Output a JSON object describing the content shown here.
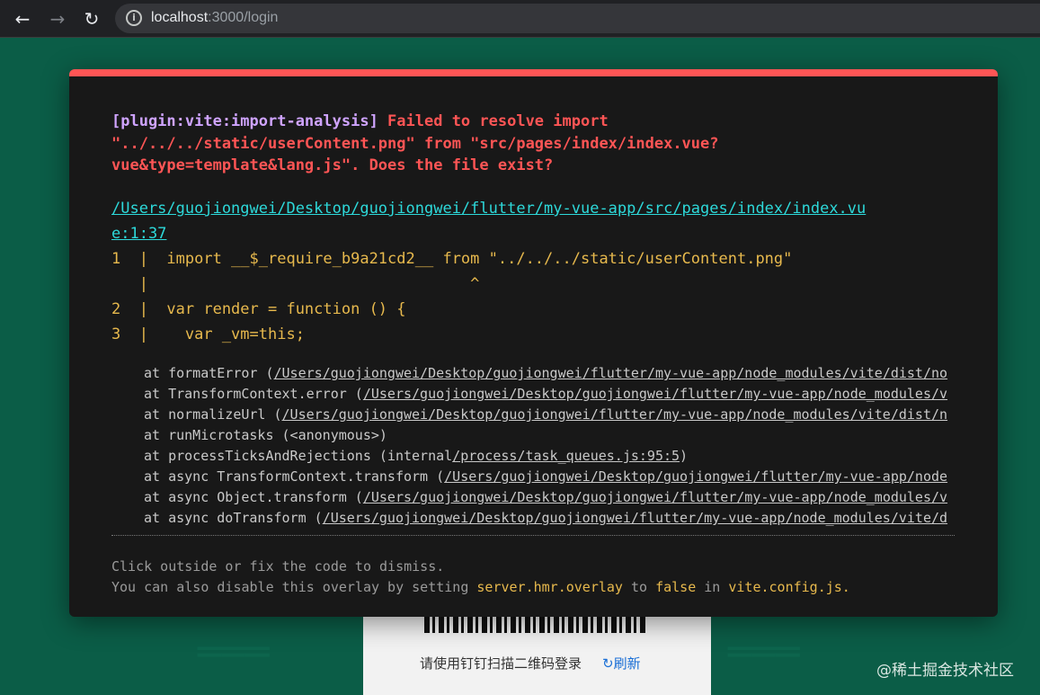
{
  "browser": {
    "back_icon": "←",
    "forward_icon": "→",
    "reload_icon": "↻",
    "info_icon": "i",
    "url_host": "localhost",
    "url_rest": ":3000/login"
  },
  "overlay": {
    "plugin": "[plugin:vite:import-analysis]",
    "message_line1": " Failed to resolve import",
    "message_line2": "\"../../../static/userContent.png\" from \"src/pages/index/index.vue?",
    "message_line3": "vue&type=template&lang.js\". Does the file exist?",
    "file_line1": "/Users/guojiongwei/Desktop/guojiongwei/flutter/my-vue-app/src/pages/index/index.vu",
    "file_line2": "e:1:37",
    "frame": [
      "1  |  import __$_require_b9a21cd2__ from \"../../../static/userContent.png\"",
      "   |                                   ^",
      "2  |  var render = function () {",
      "3  |    var _vm=this;"
    ],
    "stack": [
      {
        "prefix": "at formatError (",
        "link": "/Users/guojiongwei/Desktop/guojiongwei/flutter/my-vue-app/node_modules/vite/dist/no",
        "suffix": ""
      },
      {
        "prefix": "at TransformContext.error (",
        "link": "/Users/guojiongwei/Desktop/guojiongwei/flutter/my-vue-app/node_modules/v",
        "suffix": ""
      },
      {
        "prefix": "at normalizeUrl (",
        "link": "/Users/guojiongwei/Desktop/guojiongwei/flutter/my-vue-app/node_modules/vite/dist/n",
        "suffix": ""
      },
      {
        "prefix": "at runMicrotasks (<anonymous>)",
        "link": "",
        "suffix": ""
      },
      {
        "prefix": "at processTicksAndRejections (internal",
        "link": "/process/task_queues.js:95:5",
        "suffix": ")"
      },
      {
        "prefix": "at async TransformContext.transform (",
        "link": "/Users/guojiongwei/Desktop/guojiongwei/flutter/my-vue-app/node",
        "suffix": ""
      },
      {
        "prefix": "at async Object.transform (",
        "link": "/Users/guojiongwei/Desktop/guojiongwei/flutter/my-vue-app/node_modules/v",
        "suffix": ""
      },
      {
        "prefix": "at async doTransform (",
        "link": "/Users/guojiongwei/Desktop/guojiongwei/flutter/my-vue-app/node_modules/vite/d",
        "suffix": ""
      }
    ],
    "tip_line1": "Click outside or fix the code to dismiss.",
    "tip_line2_a": "You can also disable this overlay by setting ",
    "tip_line2_code1": "server.hmr.overlay",
    "tip_line2_b": " to ",
    "tip_line2_code2": "false",
    "tip_line2_c": " in ",
    "tip_line2_code3": "vite.config.js."
  },
  "login": {
    "qr_text": "请使用钉钉扫描二维码登录",
    "refresh_label": "刷新",
    "refresh_icon": "↻"
  },
  "watermark": "@稀土掘金技术社区",
  "colors": {
    "background": "#0b5d47",
    "overlay_accent": "#ff5555",
    "plugin_text": "#cfa4ff",
    "file_link": "#2dd9da",
    "code_frame": "#e7b94d"
  }
}
